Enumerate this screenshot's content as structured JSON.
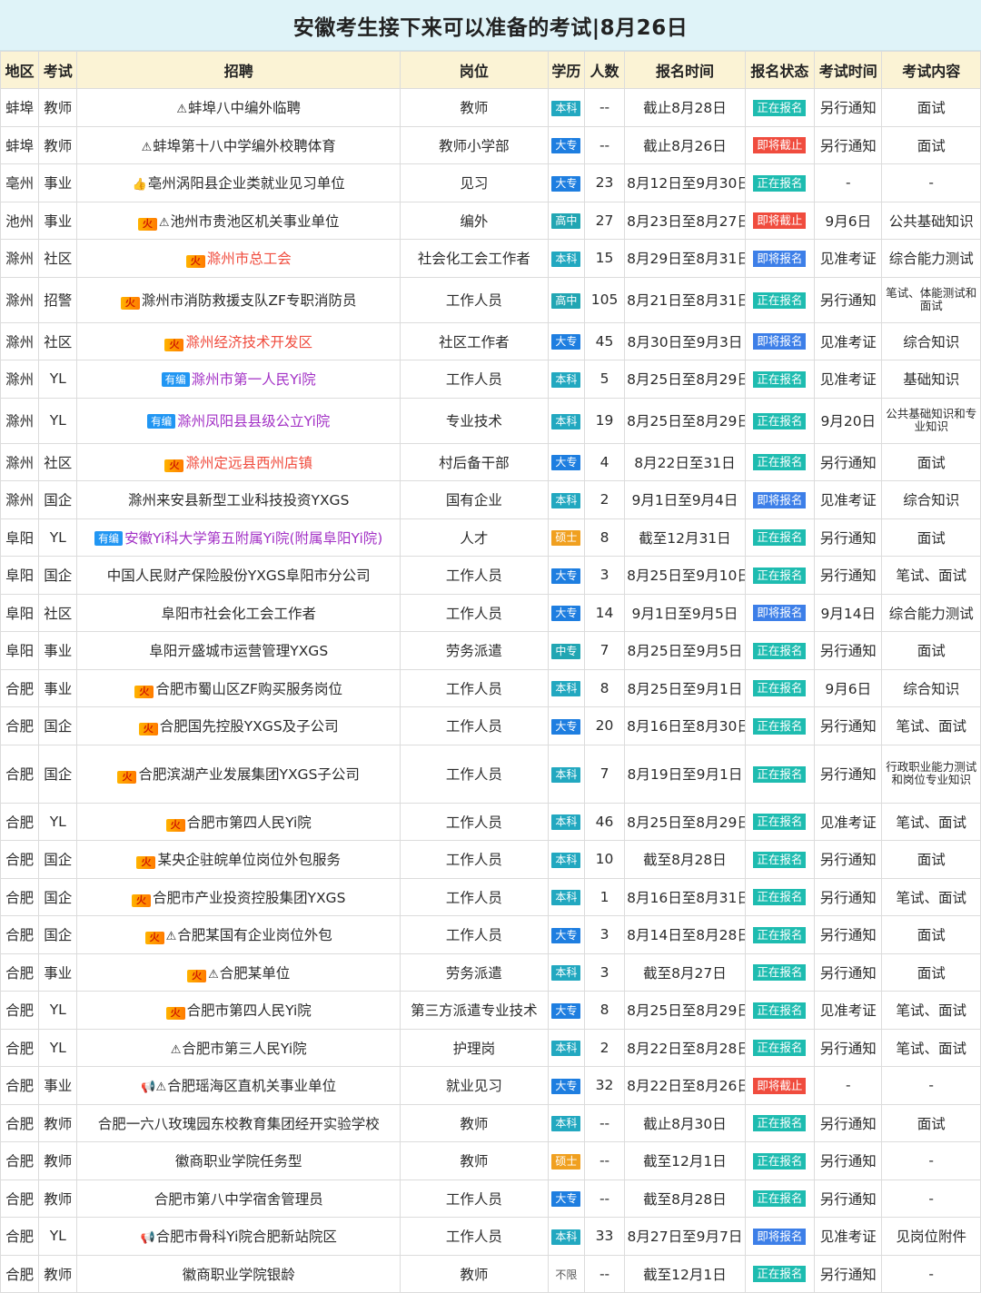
{
  "title": "安徽考生接下来可以准备的考试|8月26日",
  "headers": [
    "地区",
    "考试",
    "招聘",
    "岗位",
    "学历",
    "人数",
    "报名时间",
    "报名状态",
    "考试时间",
    "考试内容"
  ],
  "colors": {
    "header_bg": "#fbf3d5",
    "title_bg": "#dff3f8",
    "status_open": "#1ebcb0",
    "status_soon": "#3d7fe8",
    "status_end": "#f04c3e",
    "edu_benke": "#22a8c0",
    "edu_dazhuan": "#1e7ee0",
    "edu_gaozhong": "#22a6b3",
    "edu_shuoshi": "#f0a020",
    "edu_zhongzhuan": "#22a6b3",
    "link_red": "#f04c3e",
    "link_purple": "#a332c6"
  },
  "icons": {
    "fire_tag": "火",
    "bian_tag": "有编",
    "warning_icon": "⚠",
    "thumb_icon": "👍",
    "megaphone_icon": "📢"
  },
  "rows": [
    {
      "region": "蚌埠",
      "type": "教师",
      "tag": "",
      "icon": "⚠",
      "name": "蚌埠八中编外临聘",
      "name_color": "",
      "post": "教师",
      "edu": "本科",
      "edu_color": "#22a8c0",
      "count": "--",
      "time": "截止8月28日",
      "status": "正在报名",
      "status_class": "st-open",
      "exam_time": "另行通知",
      "content": "面试"
    },
    {
      "region": "蚌埠",
      "type": "教师",
      "tag": "",
      "icon": "⚠",
      "name": "蚌埠第十八中学编外校聘体育",
      "name_color": "",
      "post": "教师小学部",
      "edu": "大专",
      "edu_color": "#1e7ee0",
      "count": "--",
      "time": "截止8月26日",
      "status": "即将截止",
      "status_class": "st-end",
      "exam_time": "另行通知",
      "content": "面试"
    },
    {
      "region": "亳州",
      "type": "事业",
      "tag": "",
      "icon": "👍",
      "name": "亳州涡阳县企业类就业见习单位",
      "name_color": "",
      "post": "见习",
      "edu": "大专",
      "edu_color": "#1e7ee0",
      "count": "23",
      "time": "8月12日至9月30日",
      "status": "正在报名",
      "status_class": "st-open",
      "exam_time": "-",
      "content": "-"
    },
    {
      "region": "池州",
      "type": "事业",
      "tag": "火",
      "icon": "⚠",
      "name": "池州市贵池区机关事业单位",
      "name_color": "",
      "post": "编外",
      "edu": "高中",
      "edu_color": "#22a6b3",
      "count": "27",
      "time": "8月23日至8月27日",
      "status": "即将截止",
      "status_class": "st-end",
      "exam_time": "9月6日",
      "content": "公共基础知识"
    },
    {
      "region": "滁州",
      "type": "社区",
      "tag": "火",
      "icon": "",
      "name": "滁州市总工会",
      "name_color": "red",
      "post": "社会化工会工作者",
      "edu": "本科",
      "edu_color": "#22a8c0",
      "count": "15",
      "time": "8月29日至8月31日",
      "status": "即将报名",
      "status_class": "st-soon",
      "exam_time": "见准考证",
      "content": "综合能力测试"
    },
    {
      "region": "滁州",
      "type": "招警",
      "tag": "火",
      "icon": "",
      "name": "滁州市消防救援支队ZF专职消防员",
      "name_color": "",
      "post": "工作人员",
      "edu": "高中",
      "edu_color": "#22a6b3",
      "count": "105",
      "time": "8月21日至8月31日",
      "status": "正在报名",
      "status_class": "st-open",
      "exam_time": "另行通知",
      "content": "笔试、体能测试和面试",
      "small": true,
      "rowclass": "tall"
    },
    {
      "region": "滁州",
      "type": "社区",
      "tag": "火",
      "icon": "",
      "name": "滁州经济技术开发区",
      "name_color": "red",
      "post": "社区工作者",
      "edu": "大专",
      "edu_color": "#1e7ee0",
      "count": "45",
      "time": "8月30日至9月3日",
      "status": "即将报名",
      "status_class": "st-soon",
      "exam_time": "见准考证",
      "content": "综合知识"
    },
    {
      "region": "滁州",
      "type": "YL",
      "tag": "有编",
      "icon": "",
      "name": "滁州市第一人民Yi院",
      "name_color": "purple",
      "post": "工作人员",
      "edu": "本科",
      "edu_color": "#22a8c0",
      "count": "5",
      "time": "8月25日至8月29日",
      "status": "正在报名",
      "status_class": "st-open",
      "exam_time": "见准考证",
      "content": "基础知识"
    },
    {
      "region": "滁州",
      "type": "YL",
      "tag": "有编",
      "icon": "",
      "name": "滁州凤阳县县级公立Yi院",
      "name_color": "purple",
      "post": "专业技术",
      "edu": "本科",
      "edu_color": "#22a8c0",
      "count": "19",
      "time": "8月25日至8月29日",
      "status": "正在报名",
      "status_class": "st-open",
      "exam_time": "9月20日",
      "content": "公共基础知识和专业知识",
      "small": true,
      "rowclass": "tall"
    },
    {
      "region": "滁州",
      "type": "社区",
      "tag": "火",
      "icon": "",
      "name": "滁州定远县西州店镇",
      "name_color": "red",
      "post": "村后备干部",
      "edu": "大专",
      "edu_color": "#1e7ee0",
      "count": "4",
      "time": "8月22日至31日",
      "status": "正在报名",
      "status_class": "st-open",
      "exam_time": "另行通知",
      "content": "面试"
    },
    {
      "region": "滁州",
      "type": "国企",
      "tag": "",
      "icon": "",
      "name": "滁州来安县新型工业科技投资YXGS",
      "name_color": "",
      "post": "国有企业",
      "edu": "本科",
      "edu_color": "#22a8c0",
      "count": "2",
      "time": "9月1日至9月4日",
      "status": "即将报名",
      "status_class": "st-soon",
      "exam_time": "见准考证",
      "content": "综合知识"
    },
    {
      "region": "阜阳",
      "type": "YL",
      "tag": "有编",
      "icon": "",
      "name": "安徽Yi科大学第五附属Yi院(附属阜阳Yi院)",
      "name_color": "purple",
      "post": "人才",
      "edu": "硕士",
      "edu_color": "#f0a020",
      "count": "8",
      "time": "截至12月31日",
      "status": "正在报名",
      "status_class": "st-open",
      "exam_time": "另行通知",
      "content": "面试"
    },
    {
      "region": "阜阳",
      "type": "国企",
      "tag": "",
      "icon": "",
      "name": "中国人民财产保险股份YXGS阜阳市分公司",
      "name_color": "",
      "post": "工作人员",
      "edu": "大专",
      "edu_color": "#1e7ee0",
      "count": "3",
      "time": "8月25日至9月10日",
      "status": "正在报名",
      "status_class": "st-open",
      "exam_time": "另行通知",
      "content": "笔试、面试"
    },
    {
      "region": "阜阳",
      "type": "社区",
      "tag": "",
      "icon": "",
      "name": "阜阳市社会化工会工作者",
      "name_color": "",
      "post": "工作人员",
      "edu": "大专",
      "edu_color": "#1e7ee0",
      "count": "14",
      "time": "9月1日至9月5日",
      "status": "即将报名",
      "status_class": "st-soon",
      "exam_time": "9月14日",
      "content": "综合能力测试"
    },
    {
      "region": "阜阳",
      "type": "事业",
      "tag": "",
      "icon": "",
      "name": "阜阳亓盛城市运营管理YXGS",
      "name_color": "",
      "post": "劳务派遣",
      "edu": "中专",
      "edu_color": "#22a6b3",
      "count": "7",
      "time": "8月25日至9月5日",
      "status": "正在报名",
      "status_class": "st-open",
      "exam_time": "另行通知",
      "content": "面试"
    },
    {
      "region": "合肥",
      "type": "事业",
      "tag": "火",
      "icon": "",
      "name": "合肥市蜀山区ZF购买服务岗位",
      "name_color": "",
      "post": "工作人员",
      "edu": "本科",
      "edu_color": "#22a8c0",
      "count": "8",
      "time": "8月25日至9月1日",
      "status": "正在报名",
      "status_class": "st-open",
      "exam_time": "9月6日",
      "content": "综合知识"
    },
    {
      "region": "合肥",
      "type": "国企",
      "tag": "火",
      "icon": "",
      "name": "合肥国先控股YXGS及子公司",
      "name_color": "",
      "post": "工作人员",
      "edu": "大专",
      "edu_color": "#1e7ee0",
      "count": "20",
      "time": "8月16日至8月30日",
      "status": "正在报名",
      "status_class": "st-open",
      "exam_time": "另行通知",
      "content": "笔试、面试"
    },
    {
      "region": "合肥",
      "type": "国企",
      "tag": "火",
      "icon": "",
      "name": "合肥滨湖产业发展集团YXGS子公司",
      "name_color": "",
      "post": "工作人员",
      "edu": "本科",
      "edu_color": "#22a8c0",
      "count": "7",
      "time": "8月19日至9月1日",
      "status": "正在报名",
      "status_class": "st-open",
      "exam_time": "另行通知",
      "content": "行政职业能力测试和岗位专业知识",
      "small": true,
      "rowclass": "xtall"
    },
    {
      "region": "合肥",
      "type": "YL",
      "tag": "火",
      "icon": "",
      "name": "合肥市第四人民Yi院",
      "name_color": "",
      "post": "工作人员",
      "edu": "本科",
      "edu_color": "#22a8c0",
      "count": "46",
      "time": "8月25日至8月29日",
      "status": "正在报名",
      "status_class": "st-open",
      "exam_time": "见准考证",
      "content": "笔试、面试"
    },
    {
      "region": "合肥",
      "type": "国企",
      "tag": "火",
      "icon": "",
      "name": "某央企驻皖单位岗位外包服务",
      "name_color": "",
      "post": "工作人员",
      "edu": "本科",
      "edu_color": "#22a8c0",
      "count": "10",
      "time": "截至8月28日",
      "status": "正在报名",
      "status_class": "st-open",
      "exam_time": "另行通知",
      "content": "面试"
    },
    {
      "region": "合肥",
      "type": "国企",
      "tag": "火",
      "icon": "",
      "name": "合肥市产业投资控股集团YXGS",
      "name_color": "",
      "post": "工作人员",
      "edu": "本科",
      "edu_color": "#22a8c0",
      "count": "1",
      "time": "8月16日至8月31日",
      "status": "正在报名",
      "status_class": "st-open",
      "exam_time": "另行通知",
      "content": "笔试、面试"
    },
    {
      "region": "合肥",
      "type": "国企",
      "tag": "火",
      "icon": "⚠",
      "name": "合肥某国有企业岗位外包",
      "name_color": "",
      "post": "工作人员",
      "edu": "大专",
      "edu_color": "#1e7ee0",
      "count": "3",
      "time": "8月14日至8月28日",
      "status": "正在报名",
      "status_class": "st-open",
      "exam_time": "另行通知",
      "content": "面试"
    },
    {
      "region": "合肥",
      "type": "事业",
      "tag": "火",
      "icon": "⚠",
      "name": "合肥某单位",
      "name_color": "",
      "post": "劳务派遣",
      "edu": "本科",
      "edu_color": "#22a8c0",
      "count": "3",
      "time": "截至8月27日",
      "status": "正在报名",
      "status_class": "st-open",
      "exam_time": "另行通知",
      "content": "面试"
    },
    {
      "region": "合肥",
      "type": "YL",
      "tag": "火",
      "icon": "",
      "name": "合肥市第四人民Yi院",
      "name_color": "",
      "post": "第三方派遣专业技术",
      "edu": "大专",
      "edu_color": "#1e7ee0",
      "count": "8",
      "time": "8月25日至8月29日",
      "status": "正在报名",
      "status_class": "st-open",
      "exam_time": "见准考证",
      "content": "笔试、面试"
    },
    {
      "region": "合肥",
      "type": "YL",
      "tag": "",
      "icon": "⚠",
      "name": "合肥市第三人民Yi院",
      "name_color": "",
      "post": "护理岗",
      "edu": "本科",
      "edu_color": "#22a8c0",
      "count": "2",
      "time": "8月22日至8月28日",
      "status": "正在报名",
      "status_class": "st-open",
      "exam_time": "另行通知",
      "content": "笔试、面试"
    },
    {
      "region": "合肥",
      "type": "事业",
      "tag": "",
      "icon": "📢⚠",
      "name": "合肥瑶海区直机关事业单位",
      "name_color": "",
      "post": "就业见习",
      "edu": "大专",
      "edu_color": "#1e7ee0",
      "count": "32",
      "time": "8月22日至8月26日",
      "status": "即将截止",
      "status_class": "st-end",
      "exam_time": "-",
      "content": "-"
    },
    {
      "region": "合肥",
      "type": "教师",
      "tag": "",
      "icon": "",
      "name": "合肥一六八玫瑰园东校教育集团经开实验学校",
      "name_color": "",
      "post": "教师",
      "edu": "本科",
      "edu_color": "#22a8c0",
      "count": "--",
      "time": "截止8月30日",
      "status": "正在报名",
      "status_class": "st-open",
      "exam_time": "另行通知",
      "content": "面试"
    },
    {
      "region": "合肥",
      "type": "教师",
      "tag": "",
      "icon": "",
      "name": "徽商职业学院任务型",
      "name_color": "",
      "post": "教师",
      "edu": "硕士",
      "edu_color": "#f0a020",
      "count": "--",
      "time": "截至12月1日",
      "status": "正在报名",
      "status_class": "st-open",
      "exam_time": "另行通知",
      "content": "-"
    },
    {
      "region": "合肥",
      "type": "教师",
      "tag": "",
      "icon": "",
      "name": "合肥市第八中学宿舍管理员",
      "name_color": "",
      "post": "工作人员",
      "edu": "大专",
      "edu_color": "#1e7ee0",
      "count": "--",
      "time": "截至8月28日",
      "status": "正在报名",
      "status_class": "st-open",
      "exam_time": "另行通知",
      "content": "-"
    },
    {
      "region": "合肥",
      "type": "YL",
      "tag": "",
      "icon": "📢",
      "name": "合肥市骨科Yi院合肥新站院区",
      "name_color": "",
      "post": "工作人员",
      "edu": "本科",
      "edu_color": "#22a8c0",
      "count": "33",
      "time": "8月27日至9月7日",
      "status": "即将报名",
      "status_class": "st-soon",
      "exam_time": "见准考证",
      "content": "见岗位附件"
    },
    {
      "region": "合肥",
      "type": "教师",
      "tag": "",
      "icon": "",
      "name": "徽商职业学院银龄",
      "name_color": "",
      "post": "教师",
      "edu": "不限",
      "edu_color": "",
      "count": "--",
      "time": "截至12月1日",
      "status": "正在报名",
      "status_class": "st-open",
      "exam_time": "另行通知",
      "content": "-"
    }
  ]
}
